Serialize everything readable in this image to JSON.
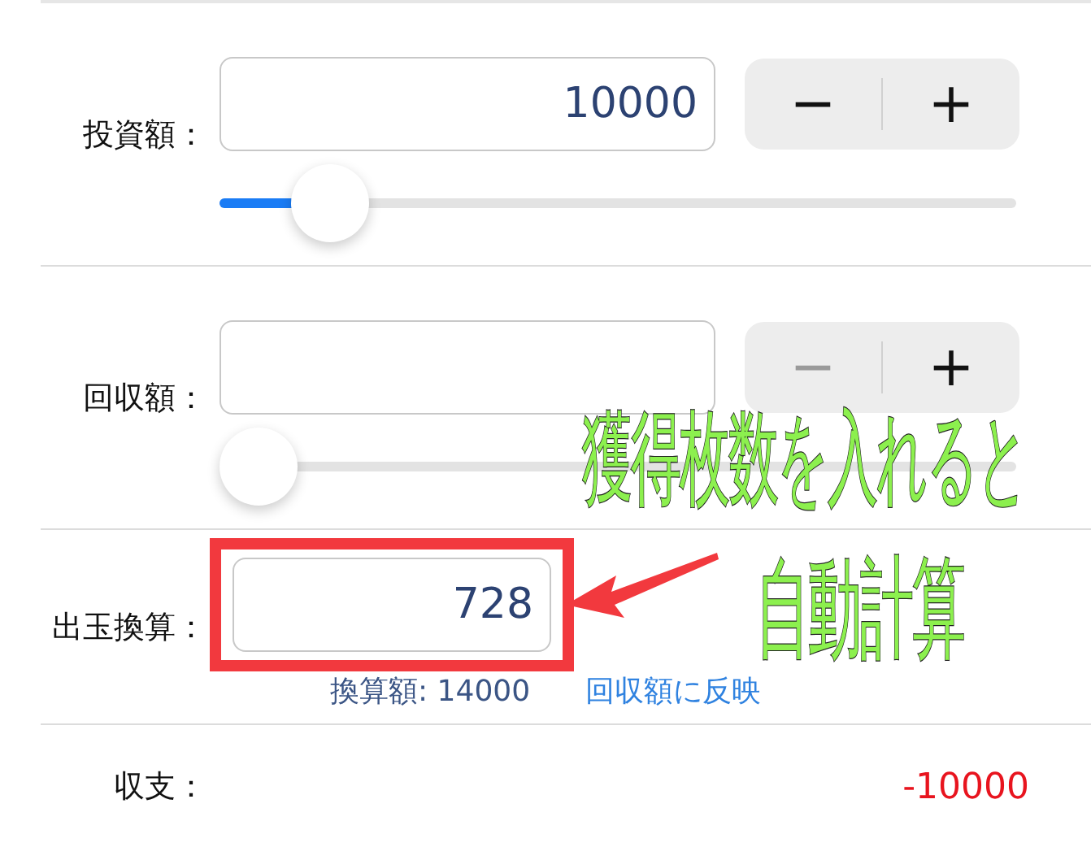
{
  "rows": [
    {
      "kind": "slider",
      "label": "投資額：",
      "value": "10000",
      "decrement": "−",
      "increment": "+",
      "decrement_disabled": false,
      "level": 0.1
    },
    {
      "kind": "slider",
      "label": "回収額：",
      "decrement": "−",
      "increment": "+",
      "decrement_disabled": true,
      "level": 0
    },
    {
      "kind": "conversion",
      "label": "出玉換算：",
      "value": "728",
      "highlighted": true,
      "converted": "換算額: 14000",
      "link": "回収額に反映"
    },
    {
      "kind": "balance",
      "label": "収支：",
      "value": "-10000"
    }
  ],
  "annotation": {
    "lines": [
      "獲得枚数を入れると",
      "自動計算"
    ]
  }
}
